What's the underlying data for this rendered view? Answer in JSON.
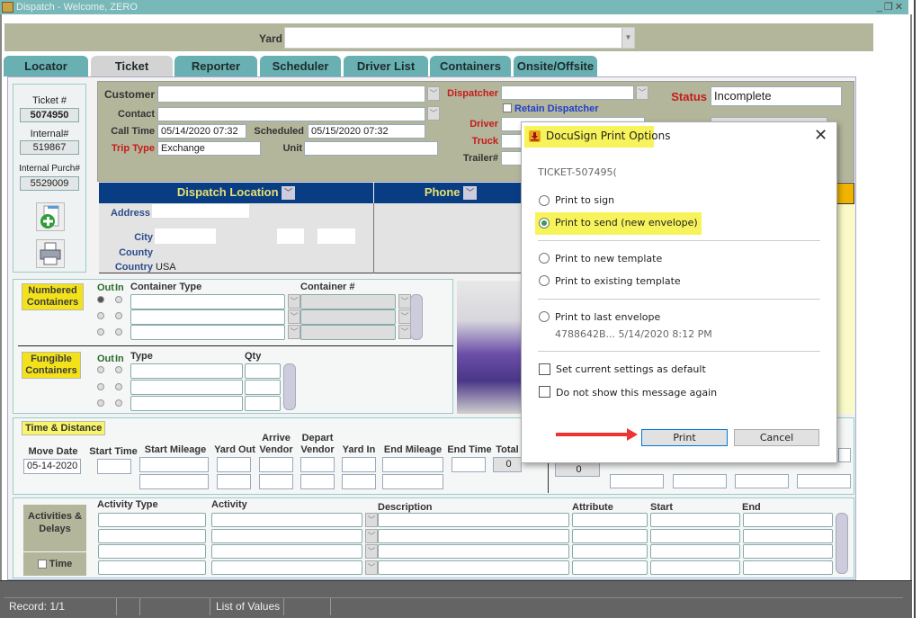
{
  "window": {
    "title": "Dispatch - Welcome, ZERO",
    "controls": [
      "minimize-icon",
      "restore-icon",
      "close-icon"
    ]
  },
  "yard": {
    "label": "Yard",
    "value": ""
  },
  "tabs": [
    {
      "label": "Locator",
      "active": false
    },
    {
      "label": "Ticket",
      "active": true
    },
    {
      "label": "Reporter",
      "active": false
    },
    {
      "label": "Scheduler",
      "active": false
    },
    {
      "label": "Driver List",
      "active": false
    },
    {
      "label": "Containers",
      "active": false
    },
    {
      "label": "Onsite/Offsite",
      "active": false
    }
  ],
  "ticket_info": {
    "ticket_label": "Ticket #",
    "ticket_value": "5074950",
    "internal_label": "Internal#",
    "internal_value": "519867",
    "purch_label": "Internal Purch#",
    "purch_value": "5529009"
  },
  "customer_section": {
    "customer_label": "Customer",
    "customer_value": "",
    "contact_label": "Contact",
    "contact_value": "",
    "calltime_label": "Call Time",
    "calltime_value": "05/14/2020 07:32",
    "scheduled_label": "Scheduled",
    "scheduled_value": "05/15/2020 07:32",
    "triptype_label": "Trip Type",
    "triptype_value": "Exchange",
    "unit_label": "Unit",
    "unit_value": "",
    "dispatcher_label": "Dispatcher",
    "dispatcher_value": "",
    "retain_label": "Retain Dispatcher",
    "driver_label": "Driver",
    "truck_label": "Truck",
    "trailer_label": "Trailer#",
    "status_label": "Status",
    "status_value": "Incomplete"
  },
  "location": {
    "header": "Dispatch Location",
    "phone_header": "Phone",
    "address_label": "Address",
    "city_label": "City",
    "county_label": "County",
    "country_label": "Country",
    "country_value": "USA"
  },
  "containers": {
    "numbered_tag": "Numbered Containers",
    "fungible_tag": "Fungible Containers",
    "out_label": "Out",
    "in_label": "In",
    "container_type_header": "Container Type",
    "container_num_header": "Container #",
    "type_header": "Type",
    "qty_header": "Qty"
  },
  "time_distance": {
    "tag": "Time &  Distance",
    "columns": [
      "Move Date",
      "Start Time",
      "Start Mileage",
      "Yard Out",
      "Arrive Vendor",
      "Depart Vendor",
      "Yard In",
      "End Mileage",
      "End Time",
      "Total"
    ],
    "move_date_value": "05-14-2020",
    "total_value": "0",
    "right_value": "0"
  },
  "activities": {
    "tag": "Activities & Delays",
    "time_label": "Time",
    "columns": [
      "Activity Type",
      "Activity",
      "Description",
      "Attribute",
      "Start",
      "End"
    ]
  },
  "statusbar": {
    "record": "Record: 1/1",
    "lov": "List of Values"
  },
  "dialog": {
    "title": "DocuSign Print Options",
    "ticket": "TICKET-507495(",
    "options": [
      {
        "label": "Print to sign",
        "selected": false
      },
      {
        "label": "Print to send (new envelope)",
        "selected": true
      },
      {
        "label": "Print to new template",
        "selected": false
      },
      {
        "label": "Print to existing template",
        "selected": false
      },
      {
        "label": "Print to last envelope",
        "selected": false
      }
    ],
    "last_envelope_info": "4788642B... 5/14/2020 8:12 PM",
    "checkboxes": [
      {
        "label": "Set current settings as default",
        "checked": false
      },
      {
        "label": "Do not show this message again",
        "checked": false
      }
    ],
    "print_label": "Print",
    "cancel_label": "Cancel"
  }
}
